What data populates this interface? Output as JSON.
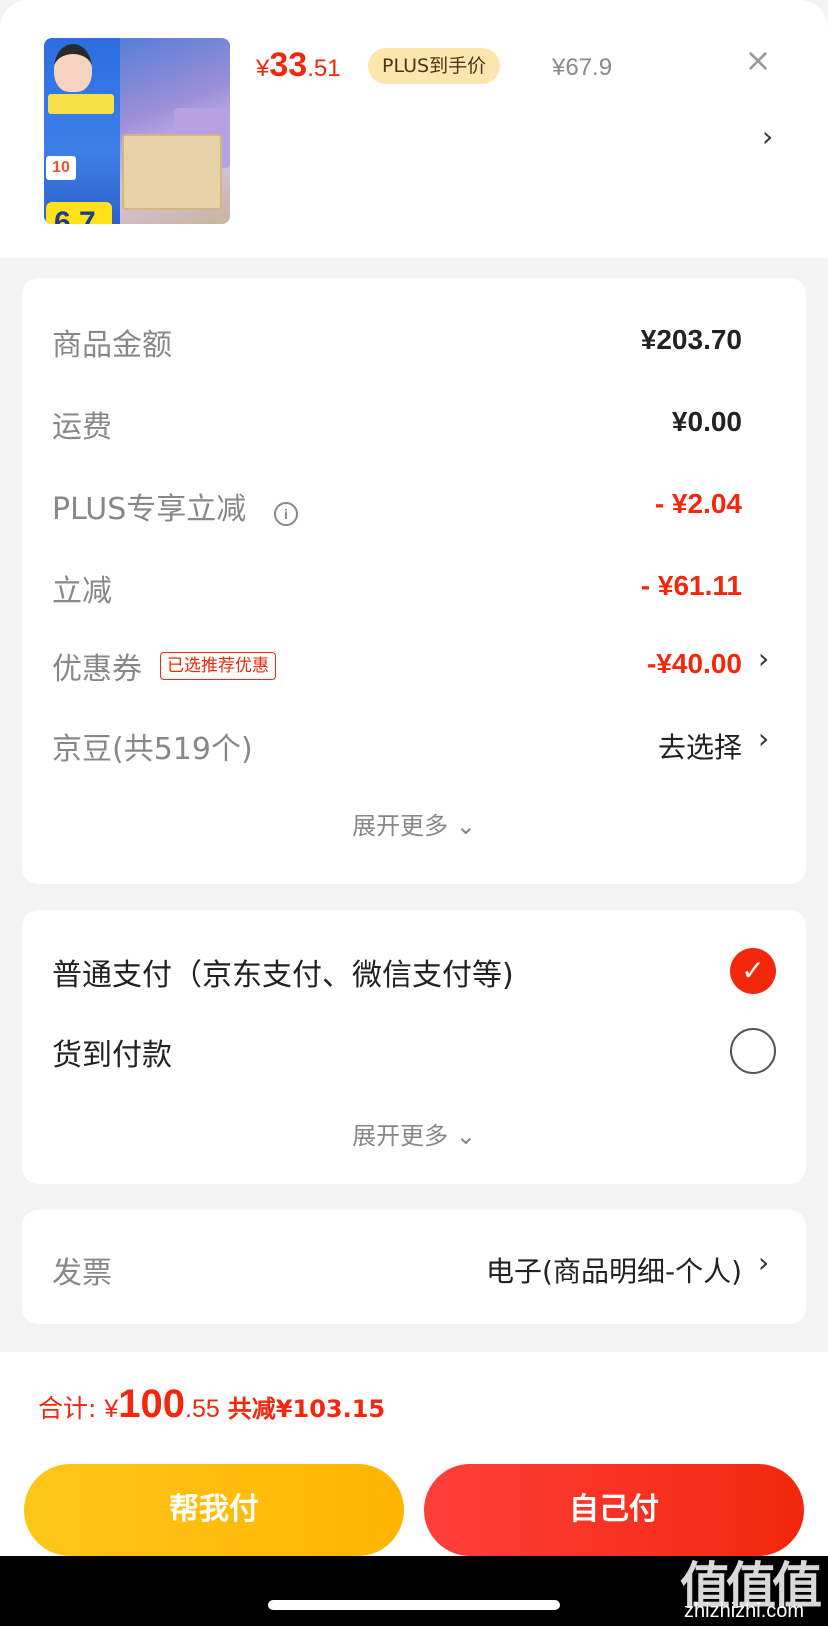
{
  "product": {
    "price_currency": "¥",
    "price_int": "33",
    "price_dec": ".51",
    "plus_label": "PLUS到手价",
    "original_price": "¥67.9",
    "thumb_discount": "6.7",
    "thumb_tag": "10"
  },
  "summary": {
    "rows": [
      {
        "label": "商品金额",
        "value": "¥203.70"
      },
      {
        "label": "运费",
        "value": "¥0.00"
      },
      {
        "label": "PLUS专享立减",
        "value": "- ¥2.04"
      },
      {
        "label": "立减",
        "value": "- ¥61.11"
      },
      {
        "label": "优惠券",
        "value": "-¥40.00",
        "tag": "已选推荐优惠"
      },
      {
        "label": "京豆(共519个)",
        "value": "去选择"
      }
    ],
    "expand_label": "展开更多"
  },
  "payment": {
    "options": [
      {
        "label": "普通支付（京东支付、微信支付等)",
        "selected": true
      },
      {
        "label": "货到付款",
        "selected": false
      }
    ],
    "expand_label": "展开更多"
  },
  "invoice": {
    "label": "发票",
    "value": "电子(商品明细-个人)"
  },
  "footer": {
    "total_label": "合计: ",
    "total_currency": "¥",
    "total_int": "100",
    "total_dec": ".55",
    "saved": "共减¥103.15",
    "helper_button": "帮我付",
    "self_button": "自己付"
  },
  "watermark": {
    "logo": "值值值",
    "site": "zhizhizhi.com"
  },
  "colors": {
    "accent_red": "#f2270c",
    "helper_yellow": "#ffc61a",
    "plus_gold": "#fbe6b0"
  }
}
